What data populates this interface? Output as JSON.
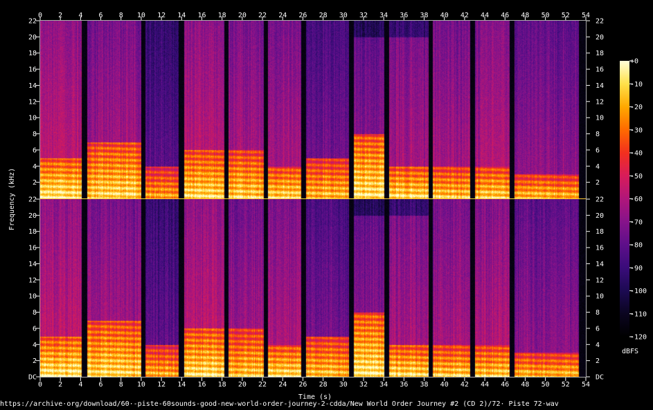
{
  "chart_data": {
    "type": "heatmap",
    "xlabel": "Time (s)",
    "ylabel": "Frequency (kHz)",
    "colorbar_label": "dBFS",
    "xlim": [
      0,
      54
    ],
    "ylim_khz": [
      0,
      22
    ],
    "time_ticks": [
      "0",
      "2",
      "4",
      "6",
      "8",
      "10",
      "12",
      "14",
      "16",
      "18",
      "20",
      "22",
      "24",
      "26",
      "28",
      "30",
      "32",
      "34",
      "36",
      "38",
      "40",
      "42",
      "44",
      "46",
      "48",
      "50",
      "52",
      "54"
    ],
    "freq_ticks_bottom": [
      "DC",
      "2",
      "4",
      "6",
      "8",
      "10",
      "12",
      "14",
      "16",
      "18",
      "20",
      "22"
    ],
    "freq_ticks_top": [
      "2",
      "4",
      "6",
      "8",
      "10",
      "12",
      "14",
      "16",
      "18",
      "20",
      "22"
    ],
    "colorbar_ticks": [
      "+0",
      "-10",
      "-20",
      "-30",
      "-40",
      "-50",
      "-60",
      "-70",
      "-80",
      "-90",
      "-100",
      "-110",
      "-120"
    ],
    "colorbar_range": [
      -120,
      0
    ],
    "channels": 2,
    "silent_gaps_s": [
      [
        4.1,
        4.6
      ],
      [
        10.0,
        10.4
      ],
      [
        13.7,
        14.2
      ],
      [
        18.2,
        18.6
      ],
      [
        22.1,
        22.5
      ],
      [
        25.8,
        26.3
      ],
      [
        30.5,
        31.0
      ],
      [
        34.0,
        34.5
      ],
      [
        38.4,
        38.8
      ],
      [
        42.5,
        43.0
      ],
      [
        46.4,
        46.9
      ],
      [
        53.3,
        54.0
      ]
    ],
    "segments": [
      {
        "start": 0.0,
        "end": 4.1,
        "hf_level": 0.55,
        "lf_level": 0.95,
        "lf_top_khz": 5
      },
      {
        "start": 4.6,
        "end": 10.0,
        "hf_level": 0.5,
        "lf_level": 0.92,
        "lf_top_khz": 7
      },
      {
        "start": 10.4,
        "end": 13.7,
        "hf_level": 0.35,
        "lf_level": 0.85,
        "lf_top_khz": 4
      },
      {
        "start": 14.2,
        "end": 18.2,
        "hf_level": 0.55,
        "lf_level": 0.93,
        "lf_top_khz": 6
      },
      {
        "start": 18.6,
        "end": 22.1,
        "hf_level": 0.5,
        "lf_level": 0.9,
        "lf_top_khz": 6
      },
      {
        "start": 22.5,
        "end": 25.8,
        "hf_level": 0.5,
        "lf_level": 0.92,
        "lf_top_khz": 4
      },
      {
        "start": 26.3,
        "end": 30.5,
        "hf_level": 0.4,
        "lf_level": 0.88,
        "lf_top_khz": 5
      },
      {
        "start": 31.0,
        "end": 34.0,
        "hf_level": 0.45,
        "lf_level": 0.95,
        "lf_top_khz": 8
      },
      {
        "start": 34.5,
        "end": 38.4,
        "hf_level": 0.5,
        "lf_level": 0.93,
        "lf_top_khz": 4
      },
      {
        "start": 38.8,
        "end": 42.5,
        "hf_level": 0.5,
        "lf_level": 0.9,
        "lf_top_khz": 4
      },
      {
        "start": 43.0,
        "end": 46.4,
        "hf_level": 0.52,
        "lf_level": 0.9,
        "lf_top_khz": 4
      },
      {
        "start": 46.9,
        "end": 53.3,
        "hf_level": 0.45,
        "lf_level": 0.88,
        "lf_top_khz": 3
      }
    ]
  },
  "colors": {
    "colormap": [
      "#000000",
      "#0b0520",
      "#1c0a52",
      "#3a0c7a",
      "#5e0f8a",
      "#86138a",
      "#b0167a",
      "#d81c5a",
      "#f2301e",
      "#ff6a00",
      "#ffa800",
      "#ffe04a",
      "#ffffd8"
    ],
    "divider": "#ffc830",
    "background": "#000000",
    "text": "#ffffff"
  },
  "footer": {
    "url": "https://archive·org/download/60·-piste-60sounds-good-new-world-order-journey-2-cdda/New World Order Journey #2 (CD 2)/72· Piste 72·wav"
  }
}
